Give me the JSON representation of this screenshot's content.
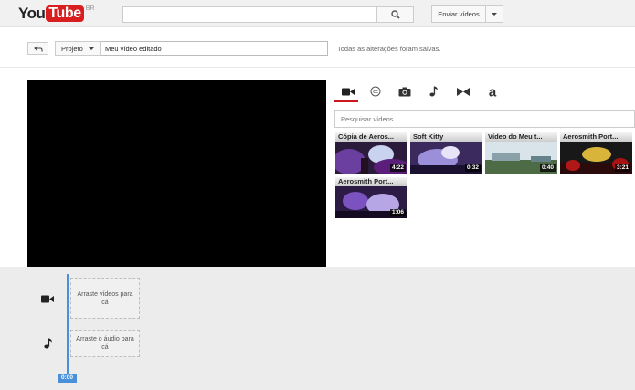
{
  "masthead": {
    "logo_you": "You",
    "logo_tube": "Tube",
    "logo_region": "BR",
    "search_placeholder": "",
    "upload_label": "Enviar vídeos"
  },
  "toolbar": {
    "project_label": "Projeto",
    "title_value": "Meu vídeo editado",
    "save_status": "Todas as alterações foram salvas."
  },
  "tabs": [
    {
      "name": "videos",
      "icon": "video-camera-icon",
      "active": true
    },
    {
      "name": "creative-commons",
      "icon": "creative-commons-icon",
      "active": false
    },
    {
      "name": "photos",
      "icon": "camera-icon",
      "active": false
    },
    {
      "name": "audio",
      "icon": "music-note-icon",
      "active": false
    },
    {
      "name": "transitions",
      "icon": "transition-icon",
      "active": false
    },
    {
      "name": "text",
      "icon": "text-icon",
      "active": false
    }
  ],
  "video_search": {
    "placeholder": "Pesquisar vídeos"
  },
  "videos": [
    {
      "title": "Cópia de Aeros...",
      "duration": "4:22"
    },
    {
      "title": "Soft Kitty",
      "duration": "0:32"
    },
    {
      "title": "Vídeo do Meu t...",
      "duration": "0:40"
    },
    {
      "title": "Aerosmith Port...",
      "duration": "3:21"
    },
    {
      "title": "Aerosmith Port...",
      "duration": "1:06"
    }
  ],
  "timeline": {
    "video_drop": "Arraste vídeos para cá",
    "audio_drop": "Arraste o áudio para cá",
    "playhead_time": "0:00"
  },
  "colors": {
    "brand_red": "#d81e1e",
    "tab_active": "#cc181e",
    "playhead": "#4a8fd9"
  }
}
